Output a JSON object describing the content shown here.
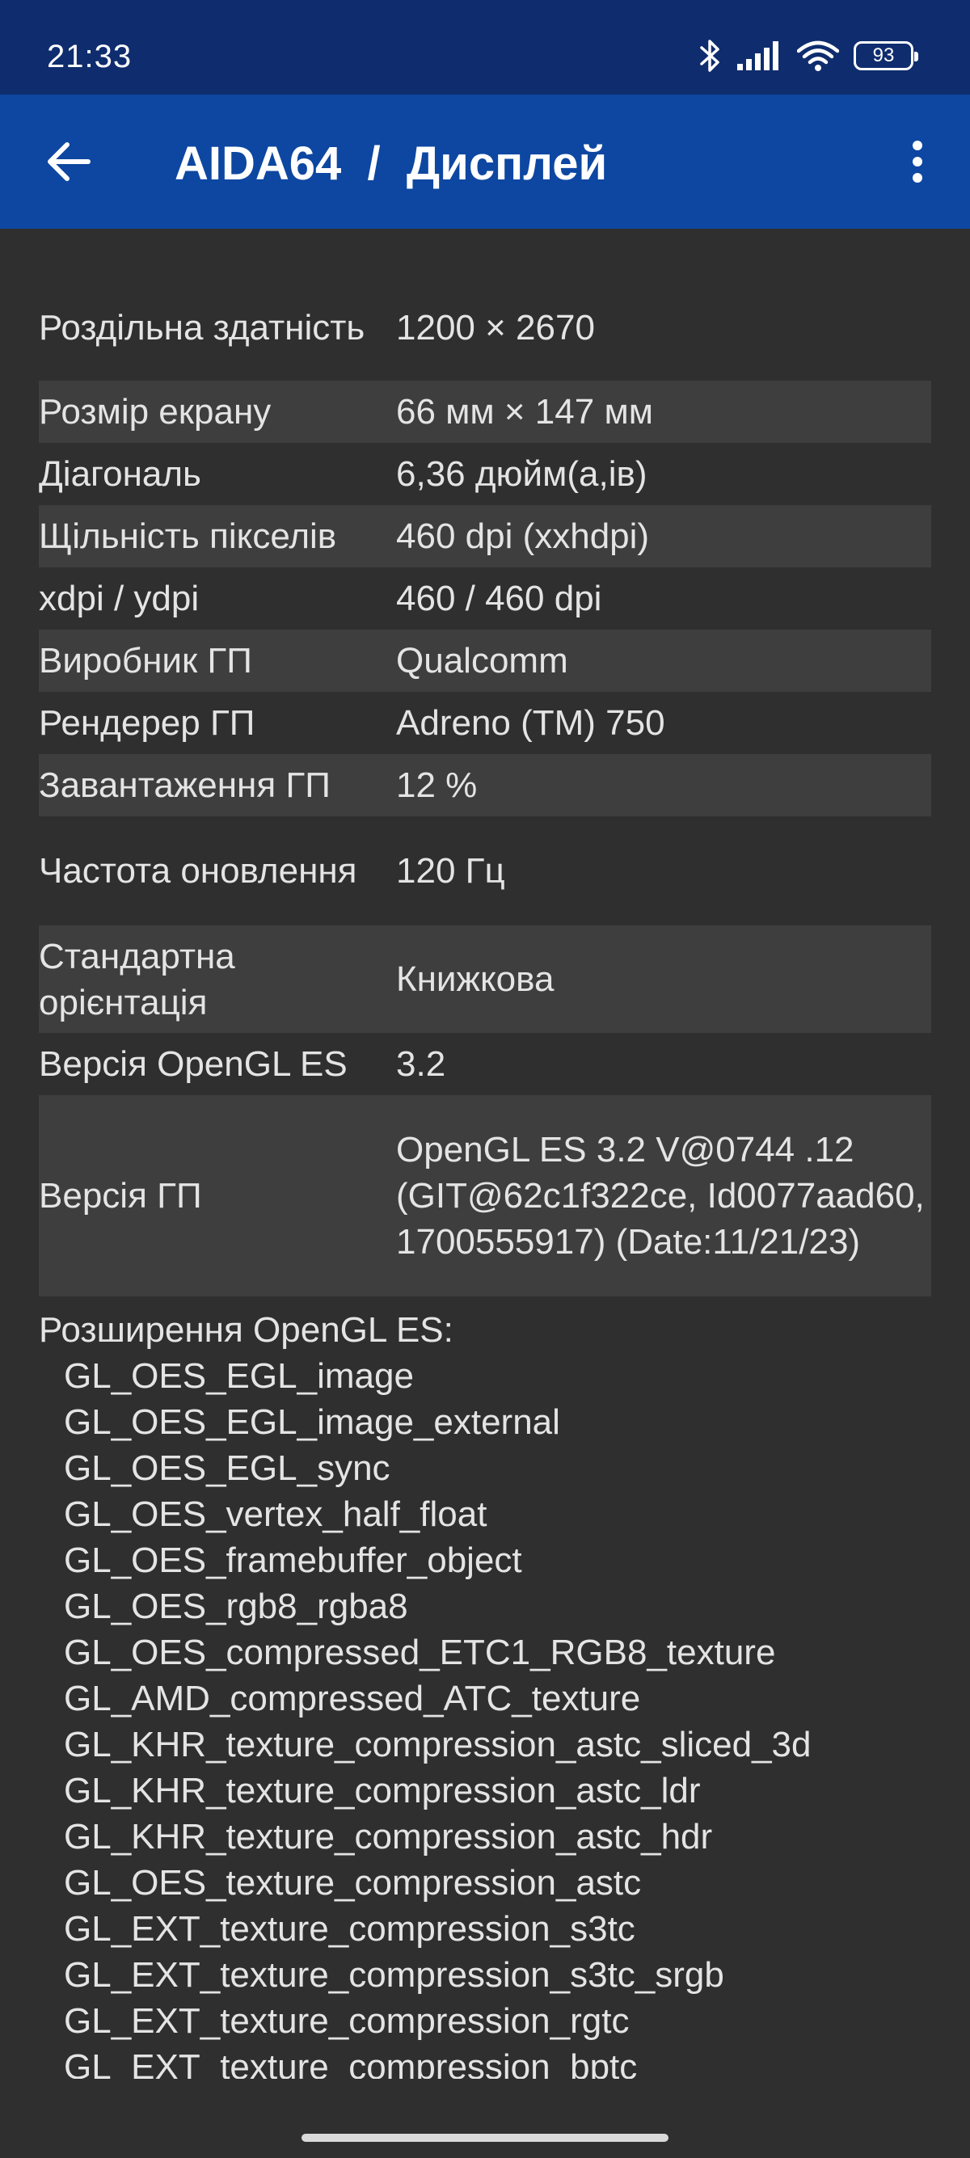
{
  "status_bar": {
    "time": "21:33",
    "battery": "93",
    "icons": [
      "bluetooth-icon",
      "signal-icon",
      "wifi-icon",
      "battery-icon"
    ]
  },
  "app_bar": {
    "title": "AIDA64  /  Дисплей",
    "back_icon": "arrow-left-icon",
    "menu_icon": "more-vert-icon",
    "color": "#0d47a1"
  },
  "rows": [
    {
      "label": "Роздільна здатність",
      "value": "1200 × 2670"
    },
    {
      "label": "Розмір екрану",
      "value": "66 мм × 147 мм"
    },
    {
      "label": "Діагональ",
      "value": "6,36 дюйм(а,ів)"
    },
    {
      "label": "Щільність пікселів",
      "value": "460 dpi (xxhdpi)"
    },
    {
      "label": "xdpi / ydpi",
      "value": "460 / 460 dpi"
    },
    {
      "label": "Виробник ГП",
      "value": "Qualcomm"
    },
    {
      "label": "Рендерер ГП",
      "value": "Adreno (TM) 750"
    },
    {
      "label": "Завантаження ГП",
      "value": "12 %"
    },
    {
      "label": "Частота оновлення",
      "value": "120 Гц"
    },
    {
      "label": "Стандартна орієнтація",
      "value": "Книжкова"
    },
    {
      "label": "Версія OpenGL ES",
      "value": "3.2"
    },
    {
      "label": "Версія ГП",
      "value": "OpenGL ES 3.2 V@0744 .12 (GIT@62c1f322ce, Id0077aad60, 1700555917) (Date:11/21/23)"
    }
  ],
  "extensions": {
    "title": "Розширення OpenGL ES:",
    "items": [
      "GL_OES_EGL_image",
      "GL_OES_EGL_image_external",
      "GL_OES_EGL_sync",
      "GL_OES_vertex_half_float",
      "GL_OES_framebuffer_object",
      "GL_OES_rgb8_rgba8",
      "GL_OES_compressed_ETC1_RGB8_texture",
      "GL_AMD_compressed_ATC_texture",
      "GL_KHR_texture_compression_astc_sliced_3d",
      "GL_KHR_texture_compression_astc_ldr",
      "GL_KHR_texture_compression_astc_hdr",
      "GL_OES_texture_compression_astc",
      "GL_EXT_texture_compression_s3tc",
      "GL_EXT_texture_compression_s3tc_srgb",
      "GL_EXT_texture_compression_rgtc",
      "GL_EXT_texture_compression_bptc"
    ]
  }
}
